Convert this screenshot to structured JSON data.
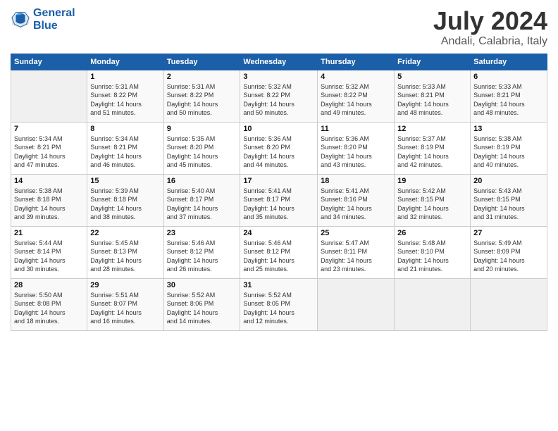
{
  "header": {
    "logo_line1": "General",
    "logo_line2": "Blue",
    "title": "July 2024",
    "subtitle": "Andali, Calabria, Italy"
  },
  "columns": [
    "Sunday",
    "Monday",
    "Tuesday",
    "Wednesday",
    "Thursday",
    "Friday",
    "Saturday"
  ],
  "weeks": [
    [
      {
        "num": "",
        "info": ""
      },
      {
        "num": "1",
        "info": "Sunrise: 5:31 AM\nSunset: 8:22 PM\nDaylight: 14 hours\nand 51 minutes."
      },
      {
        "num": "2",
        "info": "Sunrise: 5:31 AM\nSunset: 8:22 PM\nDaylight: 14 hours\nand 50 minutes."
      },
      {
        "num": "3",
        "info": "Sunrise: 5:32 AM\nSunset: 8:22 PM\nDaylight: 14 hours\nand 50 minutes."
      },
      {
        "num": "4",
        "info": "Sunrise: 5:32 AM\nSunset: 8:22 PM\nDaylight: 14 hours\nand 49 minutes."
      },
      {
        "num": "5",
        "info": "Sunrise: 5:33 AM\nSunset: 8:21 PM\nDaylight: 14 hours\nand 48 minutes."
      },
      {
        "num": "6",
        "info": "Sunrise: 5:33 AM\nSunset: 8:21 PM\nDaylight: 14 hours\nand 48 minutes."
      }
    ],
    [
      {
        "num": "7",
        "info": "Sunrise: 5:34 AM\nSunset: 8:21 PM\nDaylight: 14 hours\nand 47 minutes."
      },
      {
        "num": "8",
        "info": "Sunrise: 5:34 AM\nSunset: 8:21 PM\nDaylight: 14 hours\nand 46 minutes."
      },
      {
        "num": "9",
        "info": "Sunrise: 5:35 AM\nSunset: 8:20 PM\nDaylight: 14 hours\nand 45 minutes."
      },
      {
        "num": "10",
        "info": "Sunrise: 5:36 AM\nSunset: 8:20 PM\nDaylight: 14 hours\nand 44 minutes."
      },
      {
        "num": "11",
        "info": "Sunrise: 5:36 AM\nSunset: 8:20 PM\nDaylight: 14 hours\nand 43 minutes."
      },
      {
        "num": "12",
        "info": "Sunrise: 5:37 AM\nSunset: 8:19 PM\nDaylight: 14 hours\nand 42 minutes."
      },
      {
        "num": "13",
        "info": "Sunrise: 5:38 AM\nSunset: 8:19 PM\nDaylight: 14 hours\nand 40 minutes."
      }
    ],
    [
      {
        "num": "14",
        "info": "Sunrise: 5:38 AM\nSunset: 8:18 PM\nDaylight: 14 hours\nand 39 minutes."
      },
      {
        "num": "15",
        "info": "Sunrise: 5:39 AM\nSunset: 8:18 PM\nDaylight: 14 hours\nand 38 minutes."
      },
      {
        "num": "16",
        "info": "Sunrise: 5:40 AM\nSunset: 8:17 PM\nDaylight: 14 hours\nand 37 minutes."
      },
      {
        "num": "17",
        "info": "Sunrise: 5:41 AM\nSunset: 8:17 PM\nDaylight: 14 hours\nand 35 minutes."
      },
      {
        "num": "18",
        "info": "Sunrise: 5:41 AM\nSunset: 8:16 PM\nDaylight: 14 hours\nand 34 minutes."
      },
      {
        "num": "19",
        "info": "Sunrise: 5:42 AM\nSunset: 8:15 PM\nDaylight: 14 hours\nand 32 minutes."
      },
      {
        "num": "20",
        "info": "Sunrise: 5:43 AM\nSunset: 8:15 PM\nDaylight: 14 hours\nand 31 minutes."
      }
    ],
    [
      {
        "num": "21",
        "info": "Sunrise: 5:44 AM\nSunset: 8:14 PM\nDaylight: 14 hours\nand 30 minutes."
      },
      {
        "num": "22",
        "info": "Sunrise: 5:45 AM\nSunset: 8:13 PM\nDaylight: 14 hours\nand 28 minutes."
      },
      {
        "num": "23",
        "info": "Sunrise: 5:46 AM\nSunset: 8:12 PM\nDaylight: 14 hours\nand 26 minutes."
      },
      {
        "num": "24",
        "info": "Sunrise: 5:46 AM\nSunset: 8:12 PM\nDaylight: 14 hours\nand 25 minutes."
      },
      {
        "num": "25",
        "info": "Sunrise: 5:47 AM\nSunset: 8:11 PM\nDaylight: 14 hours\nand 23 minutes."
      },
      {
        "num": "26",
        "info": "Sunrise: 5:48 AM\nSunset: 8:10 PM\nDaylight: 14 hours\nand 21 minutes."
      },
      {
        "num": "27",
        "info": "Sunrise: 5:49 AM\nSunset: 8:09 PM\nDaylight: 14 hours\nand 20 minutes."
      }
    ],
    [
      {
        "num": "28",
        "info": "Sunrise: 5:50 AM\nSunset: 8:08 PM\nDaylight: 14 hours\nand 18 minutes."
      },
      {
        "num": "29",
        "info": "Sunrise: 5:51 AM\nSunset: 8:07 PM\nDaylight: 14 hours\nand 16 minutes."
      },
      {
        "num": "30",
        "info": "Sunrise: 5:52 AM\nSunset: 8:06 PM\nDaylight: 14 hours\nand 14 minutes."
      },
      {
        "num": "31",
        "info": "Sunrise: 5:52 AM\nSunset: 8:05 PM\nDaylight: 14 hours\nand 12 minutes."
      },
      {
        "num": "",
        "info": ""
      },
      {
        "num": "",
        "info": ""
      },
      {
        "num": "",
        "info": ""
      }
    ]
  ]
}
